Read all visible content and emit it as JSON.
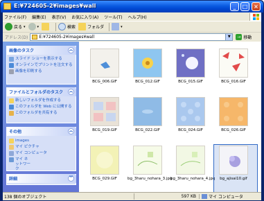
{
  "window": {
    "title": "E:¥724605-2¥images¥wall"
  },
  "menu": [
    "ファイル(F)",
    "編集(E)",
    "表示(V)",
    "お気に入り(A)",
    "ツール(T)",
    "ヘルプ(H)"
  ],
  "toolbar": {
    "back": "戻る",
    "search": "検索",
    "folders": "フォルダ"
  },
  "address": {
    "label": "アドレス(D)",
    "value": "E:¥724605-2¥images¥wall",
    "go": "移動"
  },
  "panels": {
    "tasks": {
      "title": "画像のタスク",
      "items": [
        "スライド ショーを表示する",
        "オンラインでプリントを注文する",
        "画像を印刷する"
      ]
    },
    "fileops": {
      "title": "ファイルとフォルダのタスク",
      "items": [
        "新しいフォルダを作成する",
        "このフォルダを Web に公開する",
        "このフォルダを共有する"
      ]
    },
    "other": {
      "title": "その他",
      "items": [
        "images",
        "マイ ピクチャ",
        "マイ コンピュータ",
        "マイ ネットワーク"
      ]
    },
    "details": {
      "title": "詳細"
    }
  },
  "files": [
    {
      "name": "BCG_006.GIF",
      "bg": "#f3f1ec"
    },
    {
      "name": "BCG_012.GIF",
      "bg": "#8ec6f0"
    },
    {
      "name": "BCG_015.GIF",
      "bg": "#6f6fc4"
    },
    {
      "name": "BCG_016.GIF",
      "bg": "#fbfbf5"
    },
    {
      "name": "BCG_019.GIF",
      "bg": "#e9e2d7"
    },
    {
      "name": "BCG_022.GIF",
      "bg": "#8fbbe6"
    },
    {
      "name": "BCG_024.GIF",
      "bg": "#aac8ee"
    },
    {
      "name": "BCG_026.GIF",
      "bg": "#f6b76a"
    },
    {
      "name": "BCG_029.GIF",
      "bg": "#f3f2b6"
    },
    {
      "name": "bg_3haru_nohara_3.jpg",
      "bg": "#f6fbe8"
    },
    {
      "name": "bg_3haru_nohara_4.jpg",
      "bg": "#f2f8e4"
    },
    {
      "name": "bg_ajisai10.gif",
      "bg": "#f4f4f8"
    }
  ],
  "status": {
    "objects": "138 個のオブジェクト",
    "size": "597 KB",
    "location": "マイ コンピュータ"
  }
}
